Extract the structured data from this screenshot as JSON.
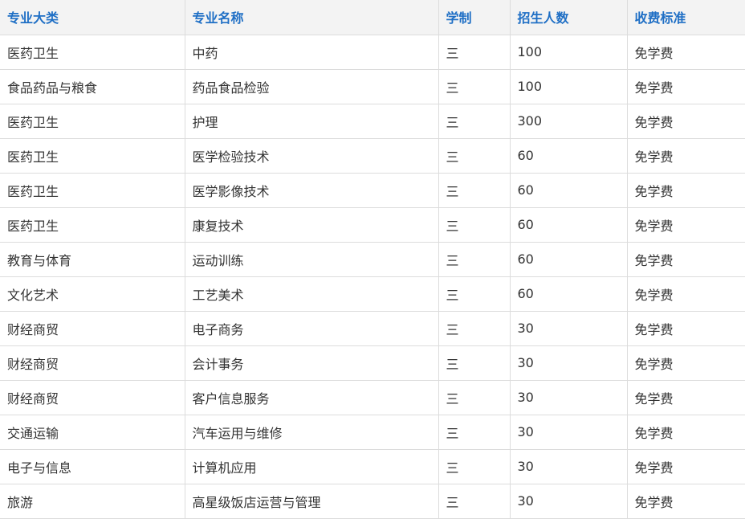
{
  "table": {
    "headers": [
      "专业大类",
      "专业名称",
      "学制",
      "招生人数",
      "收费标准"
    ],
    "rows": [
      [
        "医药卫生",
        "中药",
        "三",
        "100",
        "免学费"
      ],
      [
        "食品药品与粮食",
        "药品食品检验",
        "三",
        "100",
        "免学费"
      ],
      [
        "医药卫生",
        "护理",
        "三",
        "300",
        "免学费"
      ],
      [
        "医药卫生",
        "医学检验技术",
        "三",
        "60",
        "免学费"
      ],
      [
        "医药卫生",
        "医学影像技术",
        "三",
        "60",
        "免学费"
      ],
      [
        "医药卫生",
        "康复技术",
        "三",
        "60",
        "免学费"
      ],
      [
        "教育与体育",
        "运动训练",
        "三",
        "60",
        "免学费"
      ],
      [
        "文化艺术",
        "工艺美术",
        "三",
        "60",
        "免学费"
      ],
      [
        "财经商贸",
        "电子商务",
        "三",
        "30",
        "免学费"
      ],
      [
        "财经商贸",
        "会计事务",
        "三",
        "30",
        "免学费"
      ],
      [
        "财经商贸",
        "客户信息服务",
        "三",
        "30",
        "免学费"
      ],
      [
        "交通运输",
        "汽车运用与维修",
        "三",
        "30",
        "免学费"
      ],
      [
        "电子与信息",
        "计算机应用",
        "三",
        "30",
        "免学费"
      ],
      [
        "旅游",
        "高星级饭店运营与管理",
        "三",
        "30",
        "免学费"
      ]
    ]
  },
  "colors": {
    "header_text": "#1f6fc5",
    "header_bg": "#f3f3f3",
    "grid_line": "#dcdcdc",
    "body_text": "#333333"
  }
}
